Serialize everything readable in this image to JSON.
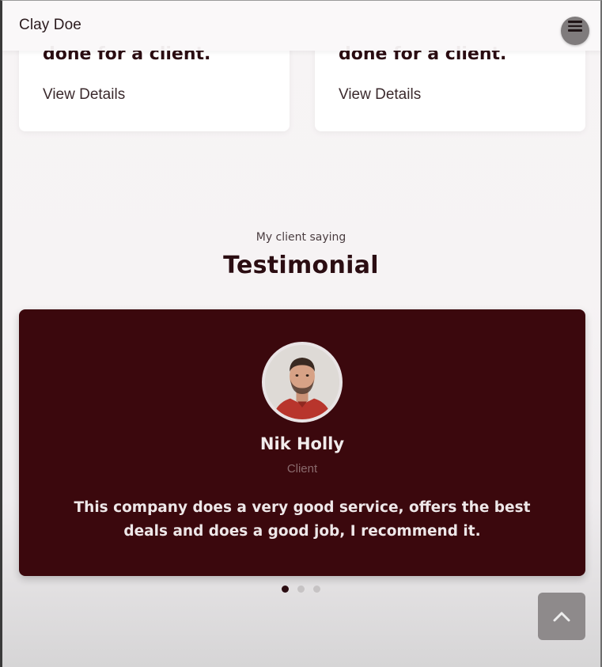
{
  "header": {
    "brand": "Clay Doe"
  },
  "projects": [
    {
      "title": "done for a client.",
      "link_label": "View Details"
    },
    {
      "title": "done for a client.",
      "link_label": "View Details"
    }
  ],
  "testimonials": {
    "subtitle": "My client saying",
    "title": "Testimonial",
    "current": {
      "name": "Nik Holly",
      "role": "Client",
      "quote": "This company does a very good service, offers the best deals and does a good job, I recommend it."
    },
    "slide_count": 3,
    "active_slide": 1
  },
  "colors": {
    "accent": "#3b080d",
    "text_dark": "#2b0d12",
    "background": "#f6f3f4"
  },
  "icons": {
    "menu": "hamburger-icon",
    "back_to_top": "chevron-up-icon"
  }
}
